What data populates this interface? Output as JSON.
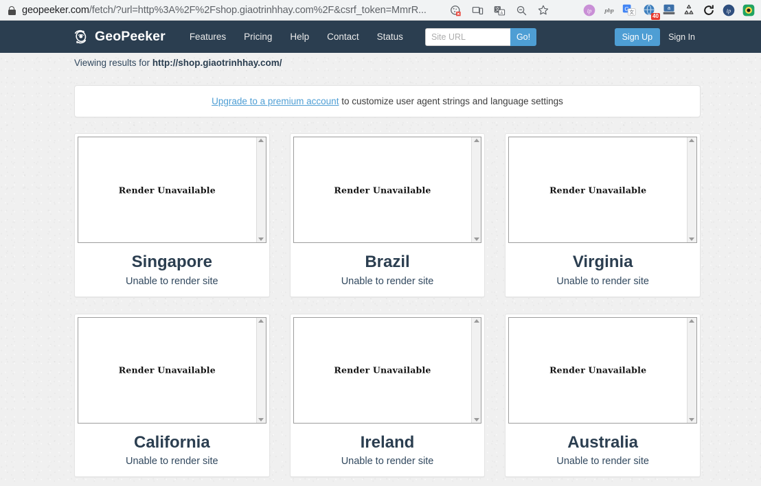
{
  "browser": {
    "url_prefix": "geopeeker.com",
    "url_suffix": "/fetch/?url=http%3A%2F%2Fshop.giaotrinhhay.com%2F&csrf_token=MmrR...",
    "icons": [
      "cookie-blocked-icon",
      "device-toolbar-icon",
      "translate-icon",
      "zoom-out-icon",
      "bookmark-star-icon"
    ],
    "extensions": [
      {
        "name": "ip-extension-purple",
        "label": "ip"
      },
      {
        "name": "php-extension",
        "label": "php"
      },
      {
        "name": "google-translate-extension",
        "label": "G"
      },
      {
        "name": "globe-extension",
        "label": "",
        "badge": "40"
      },
      {
        "name": "amazon-extension",
        "label": "a"
      },
      {
        "name": "recycle-extension",
        "label": ""
      },
      {
        "name": "refresh-extension",
        "label": ""
      },
      {
        "name": "ip-extension-blue",
        "label": "ip"
      },
      {
        "name": "camera-extension",
        "label": ""
      }
    ]
  },
  "navbar": {
    "brand": "GeoPeeker",
    "links": [
      "Features",
      "Pricing",
      "Help",
      "Contact",
      "Status"
    ],
    "search_placeholder": "Site URL",
    "search_value": "",
    "go_label": "Go!",
    "sign_up_label": "Sign Up",
    "sign_in_label": "Sign In",
    "bg_color": "#2b3e50",
    "accent_color": "#4e9ed4"
  },
  "viewing": {
    "prefix": "Viewing results for ",
    "url": "http://shop.giaotrinhhay.com/"
  },
  "banner": {
    "link_text": "Upgrade to a premium account",
    "rest_text": " to customize user agent strings and language settings"
  },
  "cards": [
    {
      "location": "Singapore",
      "render_text": "Render Unavailable",
      "status": "Unable to render site"
    },
    {
      "location": "Brazil",
      "render_text": "Render Unavailable",
      "status": "Unable to render site"
    },
    {
      "location": "Virginia",
      "render_text": "Render Unavailable",
      "status": "Unable to render site"
    },
    {
      "location": "California",
      "render_text": "Render Unavailable",
      "status": "Unable to render site"
    },
    {
      "location": "Ireland",
      "render_text": "Render Unavailable",
      "status": "Unable to render site"
    },
    {
      "location": "Australia",
      "render_text": "Render Unavailable",
      "status": "Unable to render site"
    }
  ]
}
